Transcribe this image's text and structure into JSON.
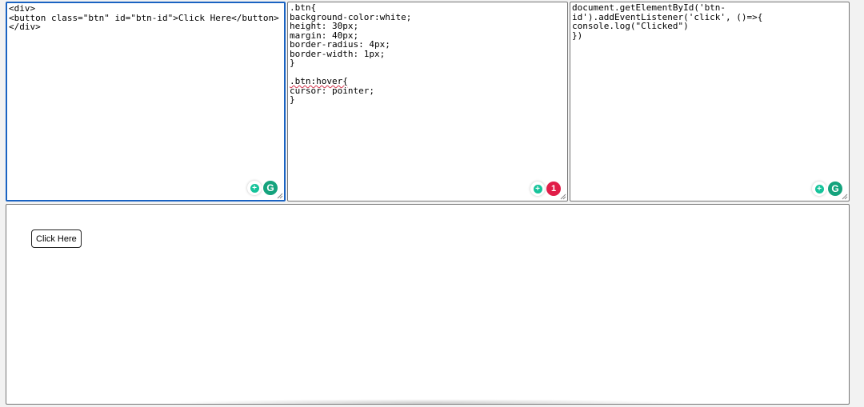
{
  "html_editor": {
    "lines": [
      "<div>",
      "<button class=\"btn\" id=\"btn-id\">Click Here</button>",
      "</div>"
    ]
  },
  "css_editor": {
    "lines": [
      ".btn{",
      "background-color:white;",
      "height: 30px;",
      "margin: 40px;",
      "border-radius: 4px;",
      "border-width: 1px;",
      "}",
      "",
      ".btn:hover{",
      "cursor: pointer;",
      "}"
    ],
    "grammarly_badge_count": "1"
  },
  "js_editor": {
    "lines": [
      "document.getElementById('btn-",
      "id').addEventListener('click', ()=>{",
      "console.log(\"Clicked\")",
      "})"
    ]
  },
  "grammarly": {
    "logo_letter": "G",
    "plus_symbol": "+"
  },
  "preview": {
    "button_label": "Click Here"
  },
  "colors": {
    "focus_border": "#1a63c2",
    "grammarly_green": "#15a37d",
    "badge_red": "#e11d48"
  }
}
